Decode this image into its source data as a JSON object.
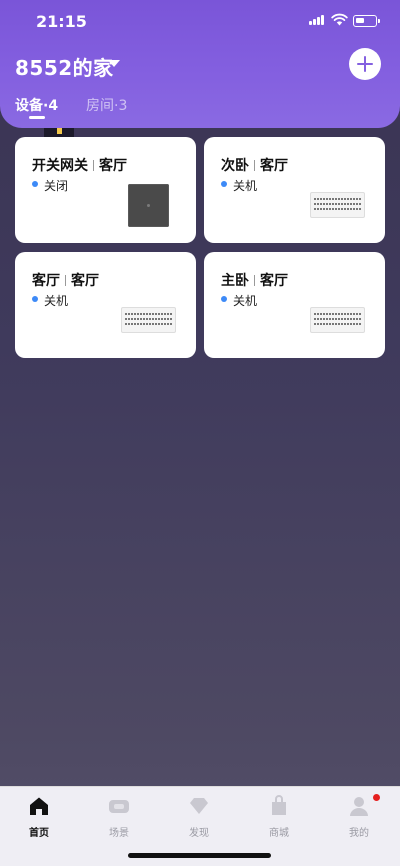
{
  "status_bar": {
    "time": "21:15"
  },
  "header": {
    "home_name": "8552的家",
    "tabs": [
      {
        "label": "设备·4",
        "active": true
      },
      {
        "label": "房间·3",
        "active": false
      }
    ]
  },
  "devices": [
    {
      "name": "开关网关",
      "room": "客厅",
      "status": "关闭",
      "image": "switch-panel"
    },
    {
      "name": "次卧",
      "room": "客厅",
      "status": "关机",
      "image": "air-conditioner"
    },
    {
      "name": "客厅",
      "room": "客厅",
      "status": "关机",
      "image": "air-conditioner"
    },
    {
      "name": "主卧",
      "room": "客厅",
      "status": "关机",
      "image": "air-conditioner"
    }
  ],
  "tabbar": {
    "items": [
      {
        "label": "首页",
        "icon": "home-icon",
        "active": true
      },
      {
        "label": "场景",
        "icon": "scene-icon",
        "active": false
      },
      {
        "label": "发现",
        "icon": "discover-icon",
        "active": false
      },
      {
        "label": "商城",
        "icon": "shop-icon",
        "active": false
      },
      {
        "label": "我的",
        "icon": "profile-icon",
        "active": false,
        "badge": true
      }
    ]
  },
  "colors": {
    "header_purple": "#8460e0",
    "status_blue": "#3d8af7",
    "badge_red": "#e51f1f"
  }
}
